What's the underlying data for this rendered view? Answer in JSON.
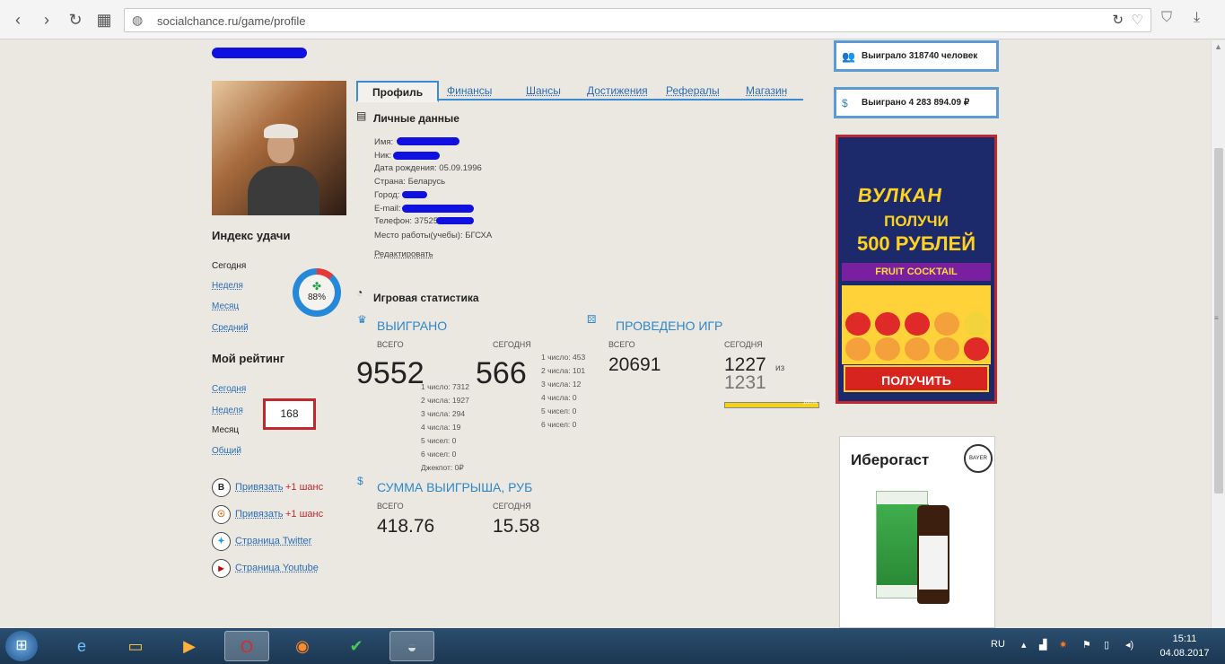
{
  "browser": {
    "url": "socialchance.ru/game/profile",
    "back_icon": "‹",
    "forward_icon": "›",
    "reload_icon": "↻",
    "apps_icon": "▦"
  },
  "tabs": [
    {
      "label": "Профиль",
      "active": true
    },
    {
      "label": "Финансы"
    },
    {
      "label": "Шансы"
    },
    {
      "label": "Достижения"
    },
    {
      "label": "Рефералы"
    },
    {
      "label": "Магазин"
    }
  ],
  "sidebar": {
    "luck_title": "Индекс удачи",
    "luck_items": [
      "Сегодня",
      "Неделя",
      "Месяц",
      "Средний"
    ],
    "luck_percent": "88%",
    "luck_fraction": 0.88,
    "rating_title": "Мой рейтинг",
    "rating_items": [
      "Сегодня",
      "Неделя",
      "Месяц",
      "Общий"
    ],
    "rating_value": "168",
    "social": [
      {
        "icon": "В",
        "link": "Привязать",
        "bonus": "+1 шанс"
      },
      {
        "icon": "ok",
        "link": "Привязать",
        "bonus": "+1 шанс"
      },
      {
        "icon": "tw",
        "link": "Страница Twitter"
      },
      {
        "icon": "yt",
        "link": "Страница Youtube"
      }
    ]
  },
  "personal": {
    "title": "Личные данные",
    "rows": [
      "Имя:",
      "Ник:",
      "Дата рождения: 05.09.1996",
      "Страна: Беларусь",
      "Город:",
      "E-mail:",
      "Телефон: 37525",
      "Место работы(учебы): БГСХА"
    ],
    "edit_link": "Редактировать"
  },
  "game_stats": {
    "title": "Игровая статистика",
    "won": {
      "title": "ВЫИГРАНО",
      "total_label": "ВСЕГО",
      "today_label": "СЕГОДНЯ",
      "total": "9552",
      "today": "566",
      "total_breakdown": [
        "1 число: 7312",
        "2 числа: 1927",
        "3 числа: 294",
        "4 числа: 19",
        "5 чисел: 0",
        "6 чисел: 0",
        "Джекпот: 0₽"
      ],
      "today_breakdown": [
        "1 число: 453",
        "2 числа: 101",
        "3 числа: 12",
        "4 числа: 0",
        "5 чисел: 0",
        "6 чисел: 0"
      ]
    },
    "played": {
      "title": "ПРОВЕДЕНО ИГР",
      "total_label": "ВСЕГО",
      "today_label": "СЕГОДНЯ",
      "total": "20691",
      "today": "1227",
      "of_label": "из",
      "of_value": "1231",
      "progress_fraction": 0.997,
      "progress_text": "100%"
    },
    "prize": {
      "title": "СУММА ВЫИГРЫША, РУБ",
      "total_label": "ВСЕГО",
      "today_label": "СЕГОДНЯ",
      "total": "418.76",
      "today": "15.58"
    }
  },
  "right": {
    "winners": "Выиграло 318740 человек",
    "prize_total": "Выиграно 4 283 894.09 ₽",
    "casino_ad": {
      "logo": "ВУЛКАН",
      "line1": "ПОЛУЧИ",
      "line2": "500 РУБЛЕЙ",
      "game": "FRUIT COCKTAIL",
      "button": "ПОЛУЧИТЬ"
    },
    "pharma_ad": {
      "brand": "Иберогаст",
      "badge": "BAYER"
    }
  },
  "taskbar": {
    "lang": "RU",
    "time": "15:11",
    "date": "04.08.2017"
  },
  "colors": {
    "accent": "#2f86c8",
    "highlight_red": "#c0282d",
    "page_bg": "#ebe8e2"
  }
}
